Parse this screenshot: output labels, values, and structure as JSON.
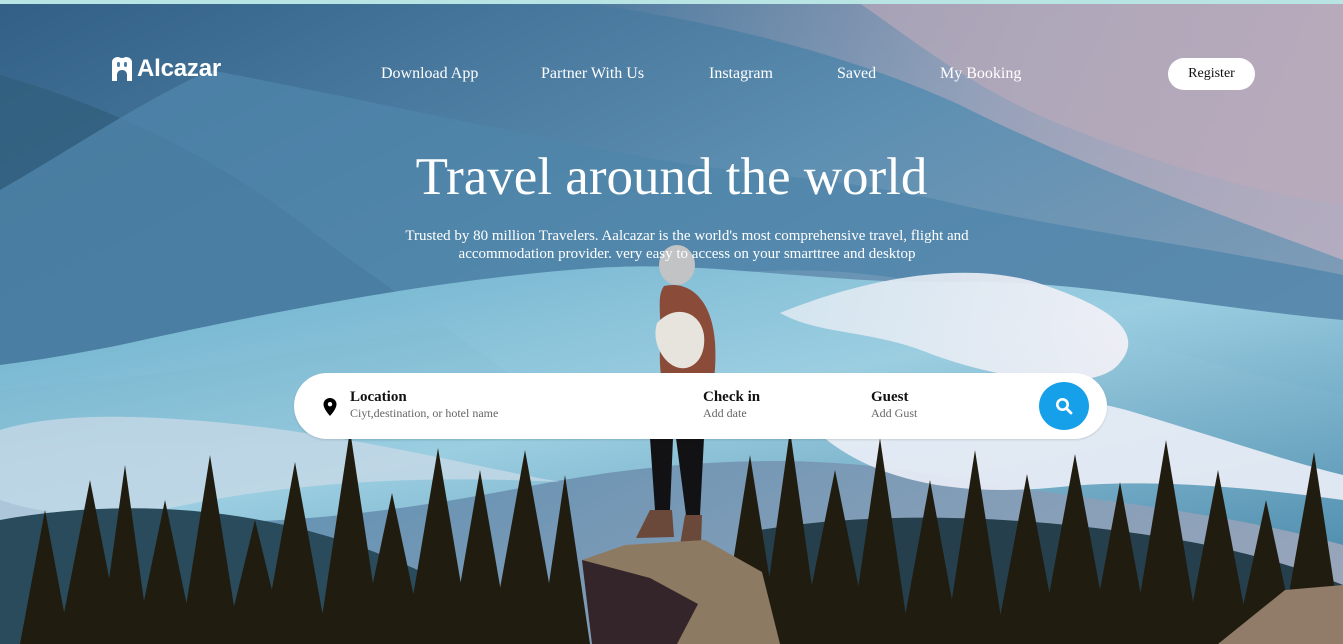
{
  "brand": {
    "name": "Alcazar",
    "icon": "castle-logo-icon",
    "accent_color": "#16a0e9",
    "top_line_color": "#b8e4e4"
  },
  "header": {
    "nav": [
      {
        "label": "Download App"
      },
      {
        "label": "Partner With Us"
      },
      {
        "label": "Instagram"
      },
      {
        "label": "Saved"
      },
      {
        "label": "My Booking"
      }
    ],
    "register_label": "Register"
  },
  "hero": {
    "title": "Travel around the world",
    "subtitle_line_1": "Trusted by 80 million Travelers. Aalcazar is the world's most comprehensive travel, flight and",
    "subtitle_line_2": "accommodation provider. very easy to access on your smarttree and desktop"
  },
  "search": {
    "location_icon": "location-pin-icon",
    "location_label": "Location",
    "location_placeholder": "Ciyt,destination, or hotel name",
    "checkin_label": "Check in",
    "checkin_placeholder": "Add date",
    "guest_label": "Guest",
    "guest_placeholder": "Add Gust",
    "search_icon": "search-icon"
  }
}
